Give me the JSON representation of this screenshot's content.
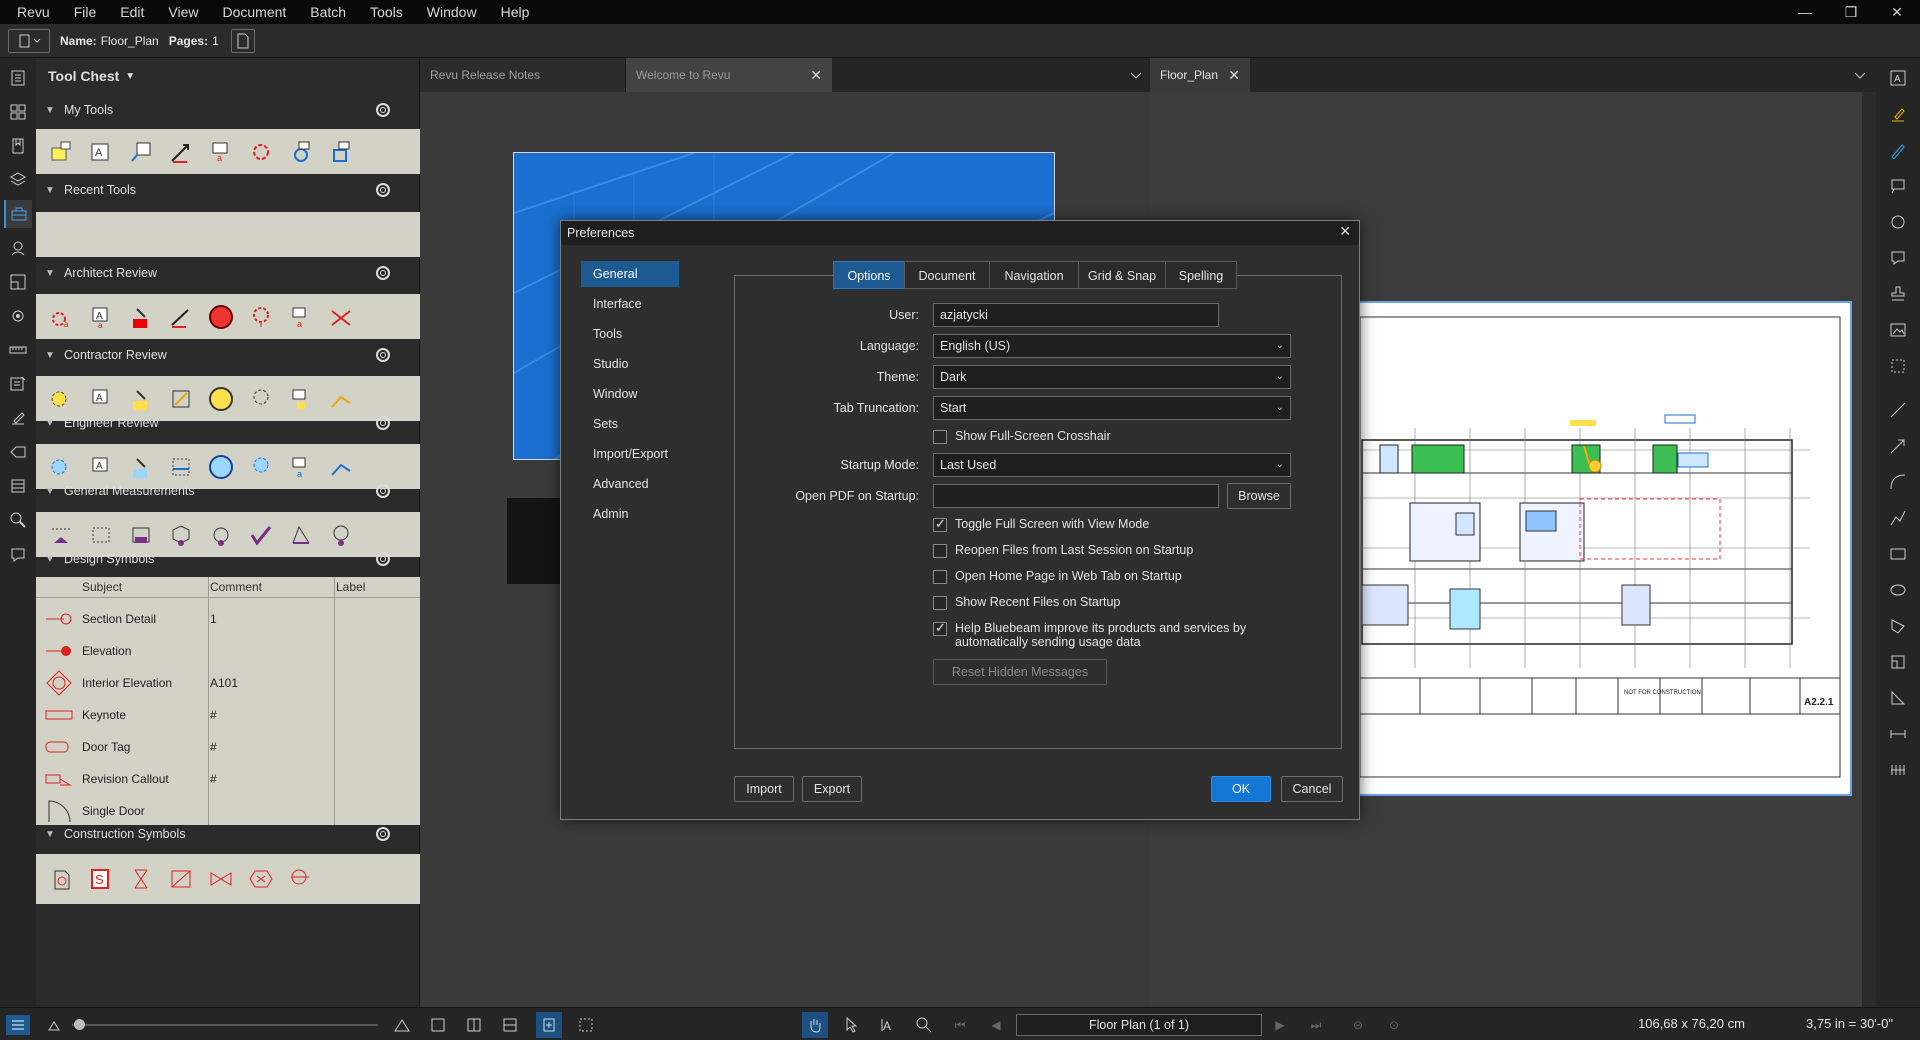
{
  "menu": [
    "Revu",
    "File",
    "Edit",
    "View",
    "Document",
    "Batch",
    "Tools",
    "Window",
    "Help"
  ],
  "window_controls": {
    "minimize": "—",
    "restore": "❐",
    "close": "✕"
  },
  "docbar": {
    "name_label": "Name:",
    "name_value": "Floor_Plan",
    "pages_label": "Pages:",
    "pages_value": "1"
  },
  "tool_chest": {
    "title": "Tool Chest",
    "sections": [
      {
        "name": "My Tools"
      },
      {
        "name": "Recent Tools"
      },
      {
        "name": "Architect Review"
      },
      {
        "name": "Contractor Review"
      },
      {
        "name": "Engineer Review"
      },
      {
        "name": "General Measurements"
      },
      {
        "name": "Design Symbols"
      },
      {
        "name": "Construction Symbols"
      }
    ],
    "symbols_table": {
      "headers": [
        "Subject",
        "Comment",
        "Label"
      ],
      "rows": [
        {
          "subject": "Section Detail",
          "comment": "1"
        },
        {
          "subject": "Elevation",
          "comment": ""
        },
        {
          "subject": "Interior Elevation",
          "comment": "A101"
        },
        {
          "subject": "Keynote",
          "comment": "#"
        },
        {
          "subject": "Door Tag",
          "comment": "#"
        },
        {
          "subject": "Revision Callout",
          "comment": "#"
        },
        {
          "subject": "Single Door",
          "comment": ""
        }
      ]
    }
  },
  "tabs_left": [
    {
      "label": "Revu Release Notes"
    },
    {
      "label": "Welcome to Revu"
    }
  ],
  "tabs_right": [
    {
      "label": "Floor_Plan"
    }
  ],
  "dialog": {
    "title": "Preferences",
    "nav": [
      "General",
      "Interface",
      "Tools",
      "Studio",
      "Window",
      "Sets",
      "Import/Export",
      "Advanced",
      "Admin"
    ],
    "selected_nav": "General",
    "tabs": [
      "Options",
      "Document",
      "Navigation",
      "Grid & Snap",
      "Spelling"
    ],
    "selected_tab": "Options",
    "fields": {
      "user_label": "User:",
      "user_value": "azjatycki",
      "language_label": "Language:",
      "language_value": "English (US)",
      "theme_label": "Theme:",
      "theme_value": "Dark",
      "tab_trunc_label": "Tab Truncation:",
      "tab_trunc_value": "Start",
      "startup_mode_label": "Startup Mode:",
      "startup_mode_value": "Last Used",
      "open_pdf_label": "Open PDF on Startup:",
      "open_pdf_value": "",
      "browse_label": "Browse"
    },
    "checkboxes": [
      {
        "label": "Show Full-Screen Crosshair",
        "checked": false
      },
      {
        "label": "Toggle Full Screen with View Mode",
        "checked": true
      },
      {
        "label": "Reopen Files from Last Session on Startup",
        "checked": false
      },
      {
        "label": "Open Home Page in Web Tab on Startup",
        "checked": false
      },
      {
        "label": "Show Recent Files on Startup",
        "checked": false
      },
      {
        "label": "Help Bluebeam improve its products and services by",
        "label2": "automatically sending usage data",
        "checked": true
      }
    ],
    "reset_label": "Reset Hidden Messages",
    "import_label": "Import",
    "export_label": "Export",
    "ok_label": "OK",
    "cancel_label": "Cancel"
  },
  "drawing": {
    "sheet_number": "A2.2.1",
    "stamp": "NOT FOR CONSTRUCTION"
  },
  "status": {
    "page_field": "Floor Plan (1 of 1)",
    "dimensions": "106,68 x 76,20 cm",
    "scale": "3,75 in = 30'-0\""
  },
  "colors": {
    "accent": "#1476d4",
    "selected": "#1d5a92",
    "tray": "#d3d2c7"
  }
}
